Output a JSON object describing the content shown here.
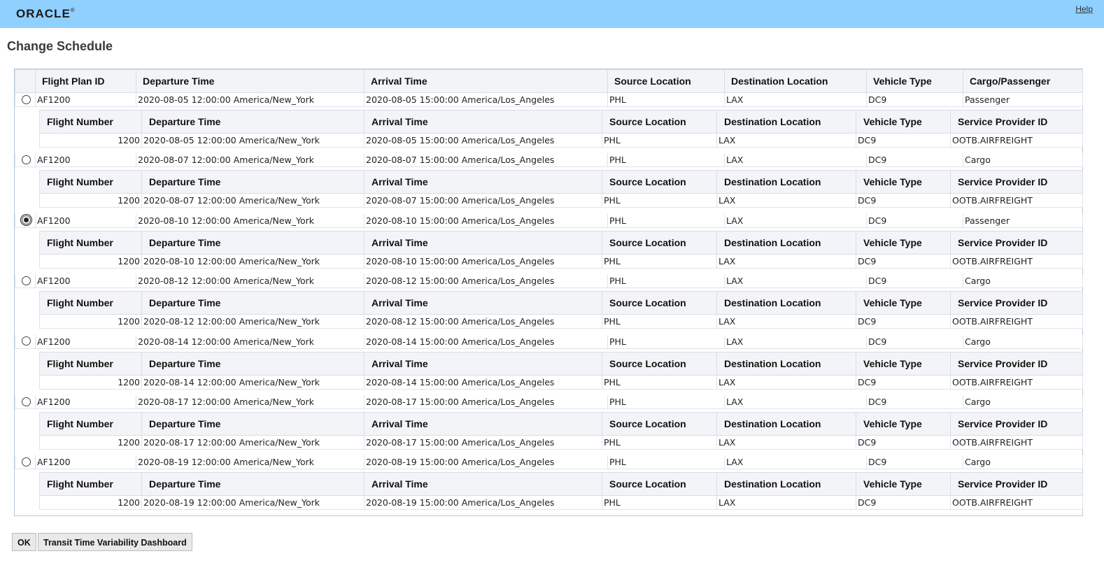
{
  "brand": {
    "logo_text": "ORACLE",
    "help_label": "Help"
  },
  "page": {
    "title": "Change Schedule"
  },
  "plan_headers": [
    "Flight Plan ID",
    "Departure Time",
    "Arrival Time",
    "Source Location",
    "Destination Location",
    "Vehicle Type",
    "Cargo/Passenger"
  ],
  "flight_headers": [
    "Flight Number",
    "Departure Time",
    "Arrival Time",
    "Source Location",
    "Destination Location",
    "Vehicle Type",
    "Service Provider ID"
  ],
  "plans": [
    {
      "id": "AF1200",
      "dep": "2020-08-05 12:00:00 America/New_York",
      "arr": "2020-08-05 15:00:00 America/Los_Angeles",
      "src": "PHL",
      "dst": "LAX",
      "veh": "DC9",
      "type": "Passenger",
      "selected": false,
      "flight": {
        "num": "1200",
        "dep": "2020-08-05 12:00:00 America/New_York",
        "arr": "2020-08-05 15:00:00 America/Los_Angeles",
        "src": "PHL",
        "dst": "LAX",
        "veh": "DC9",
        "sp": "OOTB.AIRFREIGHT"
      }
    },
    {
      "id": "AF1200",
      "dep": "2020-08-07 12:00:00 America/New_York",
      "arr": "2020-08-07 15:00:00 America/Los_Angeles",
      "src": "PHL",
      "dst": "LAX",
      "veh": "DC9",
      "type": "Cargo",
      "selected": false,
      "flight": {
        "num": "1200",
        "dep": "2020-08-07 12:00:00 America/New_York",
        "arr": "2020-08-07 15:00:00 America/Los_Angeles",
        "src": "PHL",
        "dst": "LAX",
        "veh": "DC9",
        "sp": "OOTB.AIRFREIGHT"
      }
    },
    {
      "id": "AF1200",
      "dep": "2020-08-10 12:00:00 America/New_York",
      "arr": "2020-08-10 15:00:00 America/Los_Angeles",
      "src": "PHL",
      "dst": "LAX",
      "veh": "DC9",
      "type": "Passenger",
      "selected": true,
      "flight": {
        "num": "1200",
        "dep": "2020-08-10 12:00:00 America/New_York",
        "arr": "2020-08-10 15:00:00 America/Los_Angeles",
        "src": "PHL",
        "dst": "LAX",
        "veh": "DC9",
        "sp": "OOTB.AIRFREIGHT"
      }
    },
    {
      "id": "AF1200",
      "dep": "2020-08-12 12:00:00 America/New_York",
      "arr": "2020-08-12 15:00:00 America/Los_Angeles",
      "src": "PHL",
      "dst": "LAX",
      "veh": "DC9",
      "type": "Cargo",
      "selected": false,
      "flight": {
        "num": "1200",
        "dep": "2020-08-12 12:00:00 America/New_York",
        "arr": "2020-08-12 15:00:00 America/Los_Angeles",
        "src": "PHL",
        "dst": "LAX",
        "veh": "DC9",
        "sp": "OOTB.AIRFREIGHT"
      }
    },
    {
      "id": "AF1200",
      "dep": "2020-08-14 12:00:00 America/New_York",
      "arr": "2020-08-14 15:00:00 America/Los_Angeles",
      "src": "PHL",
      "dst": "LAX",
      "veh": "DC9",
      "type": "Cargo",
      "selected": false,
      "flight": {
        "num": "1200",
        "dep": "2020-08-14 12:00:00 America/New_York",
        "arr": "2020-08-14 15:00:00 America/Los_Angeles",
        "src": "PHL",
        "dst": "LAX",
        "veh": "DC9",
        "sp": "OOTB.AIRFREIGHT"
      }
    },
    {
      "id": "AF1200",
      "dep": "2020-08-17 12:00:00 America/New_York",
      "arr": "2020-08-17 15:00:00 America/Los_Angeles",
      "src": "PHL",
      "dst": "LAX",
      "veh": "DC9",
      "type": "Cargo",
      "selected": false,
      "flight": {
        "num": "1200",
        "dep": "2020-08-17 12:00:00 America/New_York",
        "arr": "2020-08-17 15:00:00 America/Los_Angeles",
        "src": "PHL",
        "dst": "LAX",
        "veh": "DC9",
        "sp": "OOTB.AIRFREIGHT"
      }
    },
    {
      "id": "AF1200",
      "dep": "2020-08-19 12:00:00 America/New_York",
      "arr": "2020-08-19 15:00:00 America/Los_Angeles",
      "src": "PHL",
      "dst": "LAX",
      "veh": "DC9",
      "type": "Cargo",
      "selected": false,
      "flight": {
        "num": "1200",
        "dep": "2020-08-19 12:00:00 America/New_York",
        "arr": "2020-08-19 15:00:00 America/Los_Angeles",
        "src": "PHL",
        "dst": "LAX",
        "veh": "DC9",
        "sp": "OOTB.AIRFREIGHT"
      }
    }
  ],
  "buttons": {
    "ok_label": "OK",
    "dashboard_label": "Transit Time Variability Dashboard"
  }
}
